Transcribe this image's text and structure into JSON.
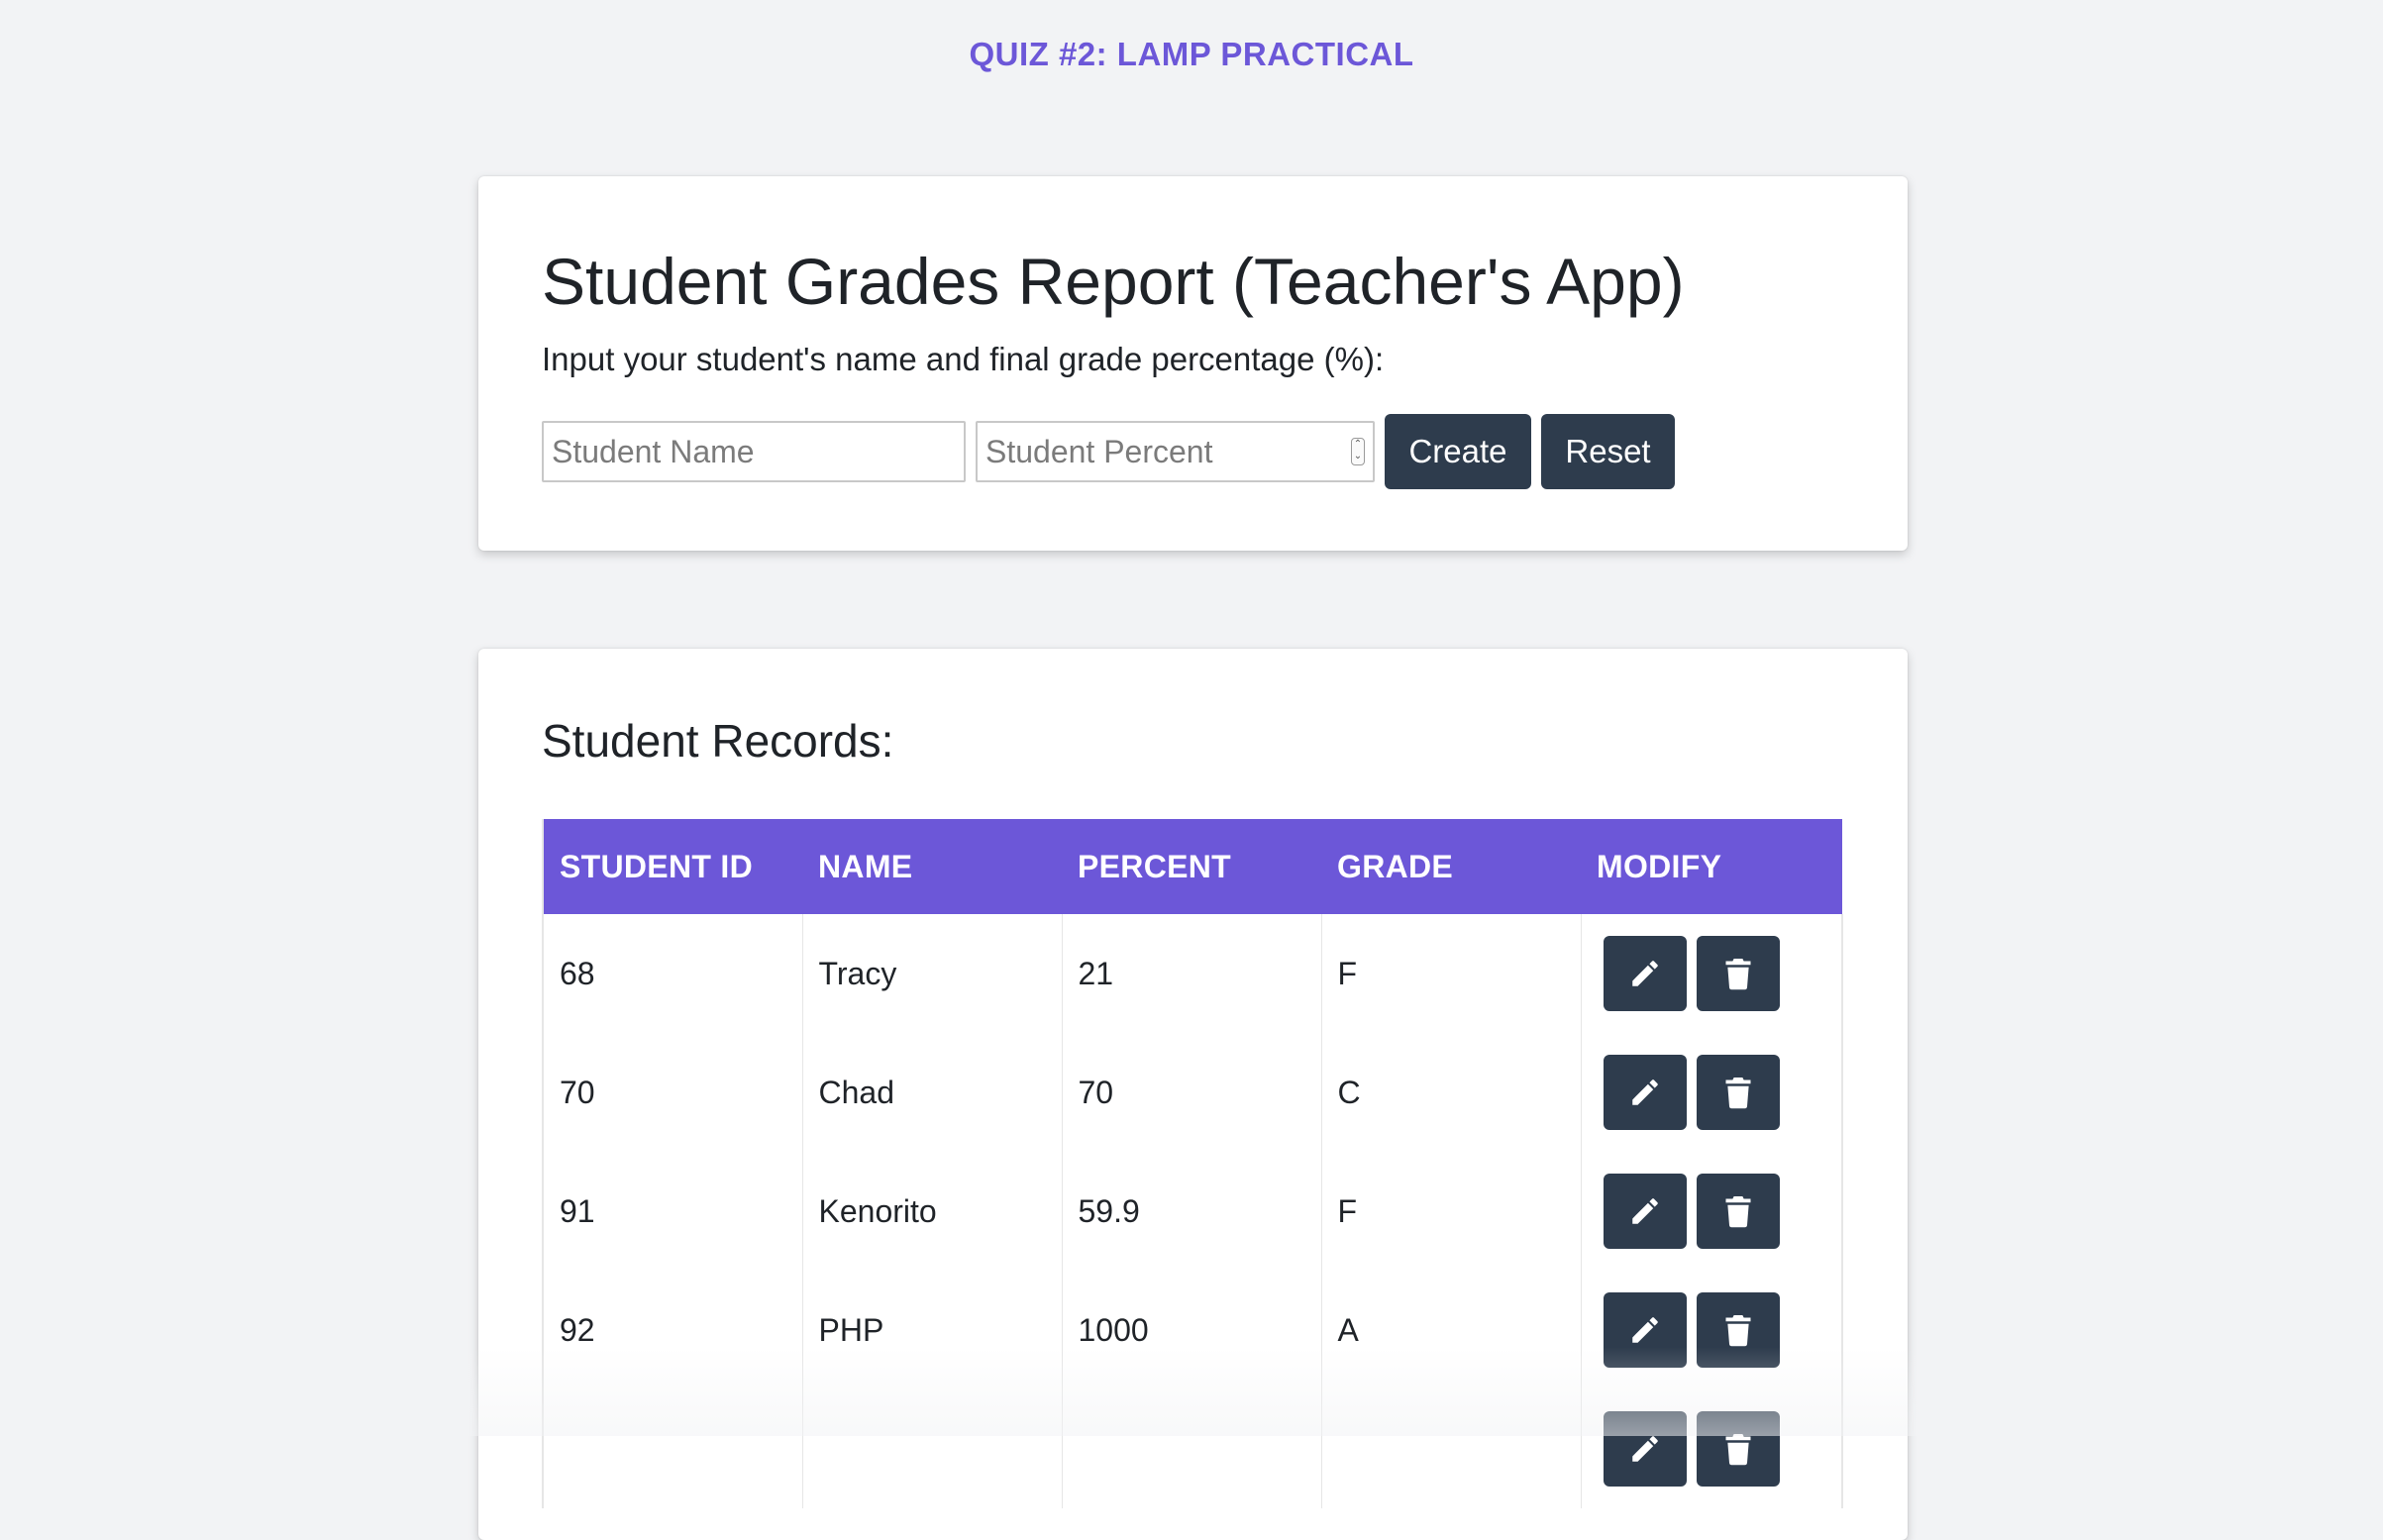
{
  "page": {
    "header": "QUIZ #2: LAMP PRACTICAL"
  },
  "form": {
    "title": "Student Grades Report (Teacher's App)",
    "subtitle": "Input your student's name and final grade percentage (%):",
    "name_placeholder": "Student Name",
    "name_value": "",
    "percent_placeholder": "Student Percent",
    "percent_value": "",
    "create_label": "Create",
    "reset_label": "Reset"
  },
  "records": {
    "title": "Student Records:",
    "columns": [
      "STUDENT ID",
      "NAME",
      "PERCENT",
      "GRADE",
      "MODIFY"
    ],
    "rows": [
      {
        "id": "68",
        "name": "Tracy",
        "percent": "21",
        "grade": "F"
      },
      {
        "id": "70",
        "name": "Chad",
        "percent": "70",
        "grade": "C"
      },
      {
        "id": "91",
        "name": "Kenorito",
        "percent": "59.9",
        "grade": "F"
      },
      {
        "id": "92",
        "name": "PHP",
        "percent": "1000",
        "grade": "A"
      },
      {
        "id": "",
        "name": "",
        "percent": "",
        "grade": ""
      }
    ],
    "row_actions": [
      "pencil-icon",
      "trash-icon"
    ]
  },
  "colors": {
    "accent": "#6c57d8",
    "button": "#2e3c4d",
    "background": "#f2f3f5"
  }
}
